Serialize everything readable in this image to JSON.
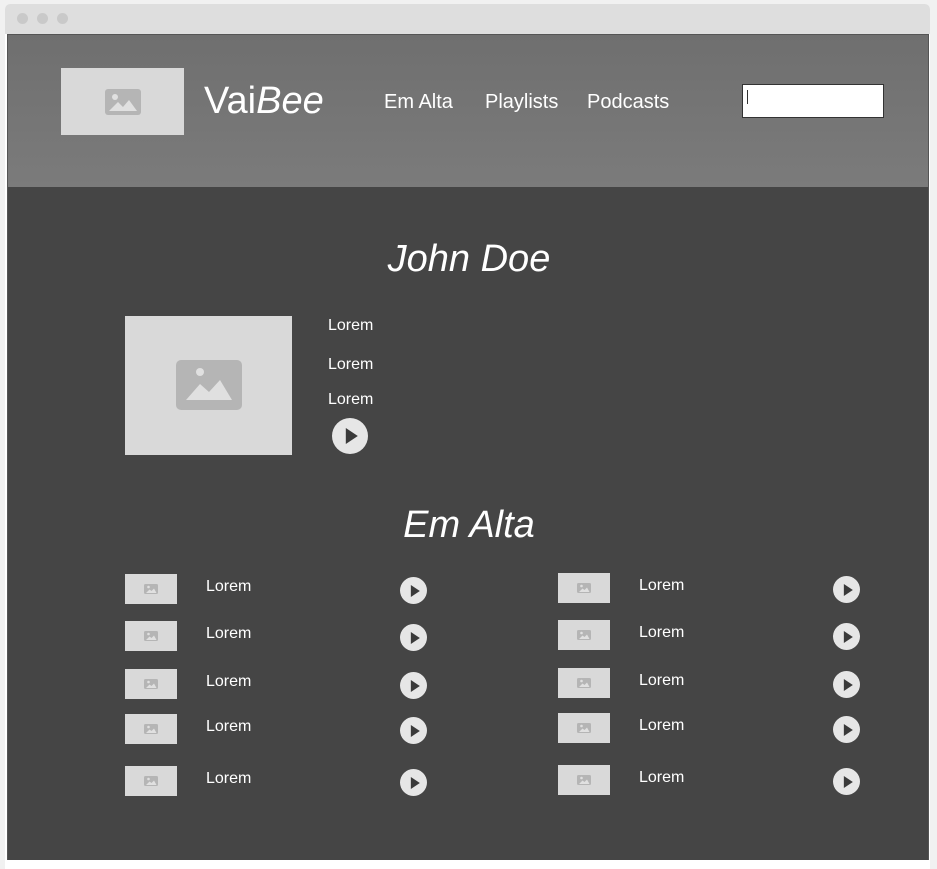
{
  "header": {
    "brand_plain": "Vai",
    "brand_italic": "Bee",
    "nav": [
      "Em Alta",
      "Playlists",
      "Podcasts"
    ],
    "search_value": ""
  },
  "profile": {
    "name": "John Doe",
    "details": [
      "Lorem",
      "Lorem",
      "Lorem"
    ]
  },
  "trending": {
    "title": "Em Alta",
    "left": [
      "Lorem",
      "Lorem",
      "Lorem",
      "Lorem",
      "Lorem"
    ],
    "right": [
      "Lorem",
      "Lorem",
      "Lorem",
      "Lorem",
      "Lorem"
    ]
  },
  "colors": {
    "header_bg": "#767676",
    "main_bg": "#454545",
    "placeholder": "#d9d9d9",
    "icon": "#b5b5b5"
  },
  "icons": {
    "image": "image-placeholder-icon",
    "play": "play-icon"
  }
}
